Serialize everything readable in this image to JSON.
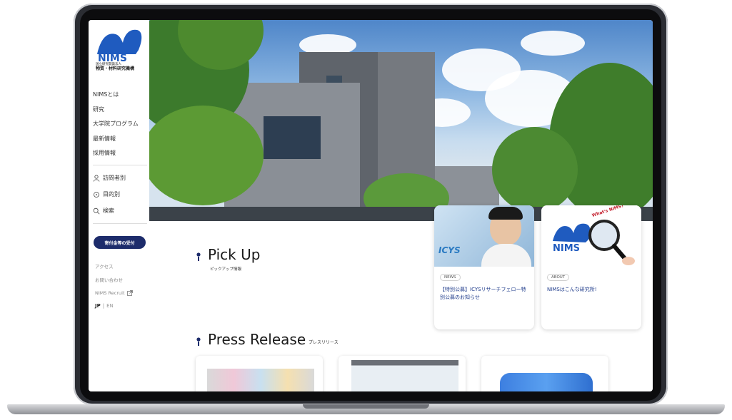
{
  "brand": {
    "logo_text": "NIMS",
    "org_name_small": "国立研究開発法人",
    "org_name": "物質・材料研究機構"
  },
  "nav": {
    "items": [
      "NIMSとは",
      "研究",
      "大学院プログラム",
      "最新情報",
      "採用情報"
    ]
  },
  "utility": {
    "visitor": "訪問者別",
    "purpose": "目的別",
    "search": "検索"
  },
  "donation_button": "寄付金等の受付",
  "links": {
    "access": "アクセス",
    "contact": "お問い合わせ",
    "nims_recruit": "NIMS Recruit"
  },
  "language": {
    "jp": "JP",
    "separator": "|",
    "en": "EN"
  },
  "pickup": {
    "title": "Pick Up",
    "subtitle": "ピックアップ情報",
    "cards": [
      {
        "tag": "NEWS",
        "text": "【特別公募】ICYSリサーチフェロー特別公募のお知らせ",
        "image_label": "ICYS"
      },
      {
        "tag": "ABOUT",
        "text": "NIMSはこんな研究所!",
        "image_label": "NIMS",
        "badge": "What's NIMS?"
      }
    ]
  },
  "press": {
    "title": "Press Release",
    "subtitle": "プレスリリース"
  },
  "colors": {
    "brand_navy": "#1d2c6b",
    "link_blue": "#1d3a8a",
    "logo_blue": "#1f5bbf"
  }
}
